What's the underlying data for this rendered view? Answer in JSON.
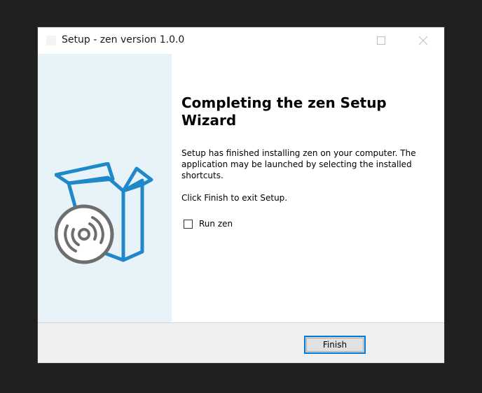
{
  "window": {
    "title": "Setup - zen version 1.0.0",
    "controls": {
      "minimize_icon": "minimize-icon",
      "maximize_icon": "maximize-icon",
      "close_icon": "close-icon"
    }
  },
  "sidebar": {
    "illustration_icon": "box-with-disc-icon"
  },
  "content": {
    "heading": "Completing the zen Setup Wizard",
    "message": "Setup has finished installing zen on your computer. The application may be launched by selecting the installed shortcuts.",
    "exit_message": "Click Finish to exit Setup.",
    "run_checkbox": {
      "label": "Run zen",
      "checked": false
    }
  },
  "footer": {
    "finish_label": "Finish"
  },
  "colors": {
    "sidebar_bg": "#e8f2f9",
    "accent_blue": "#1e88c9",
    "disc_gray": "#6e6e6e",
    "button_focus": "#0078d7"
  }
}
